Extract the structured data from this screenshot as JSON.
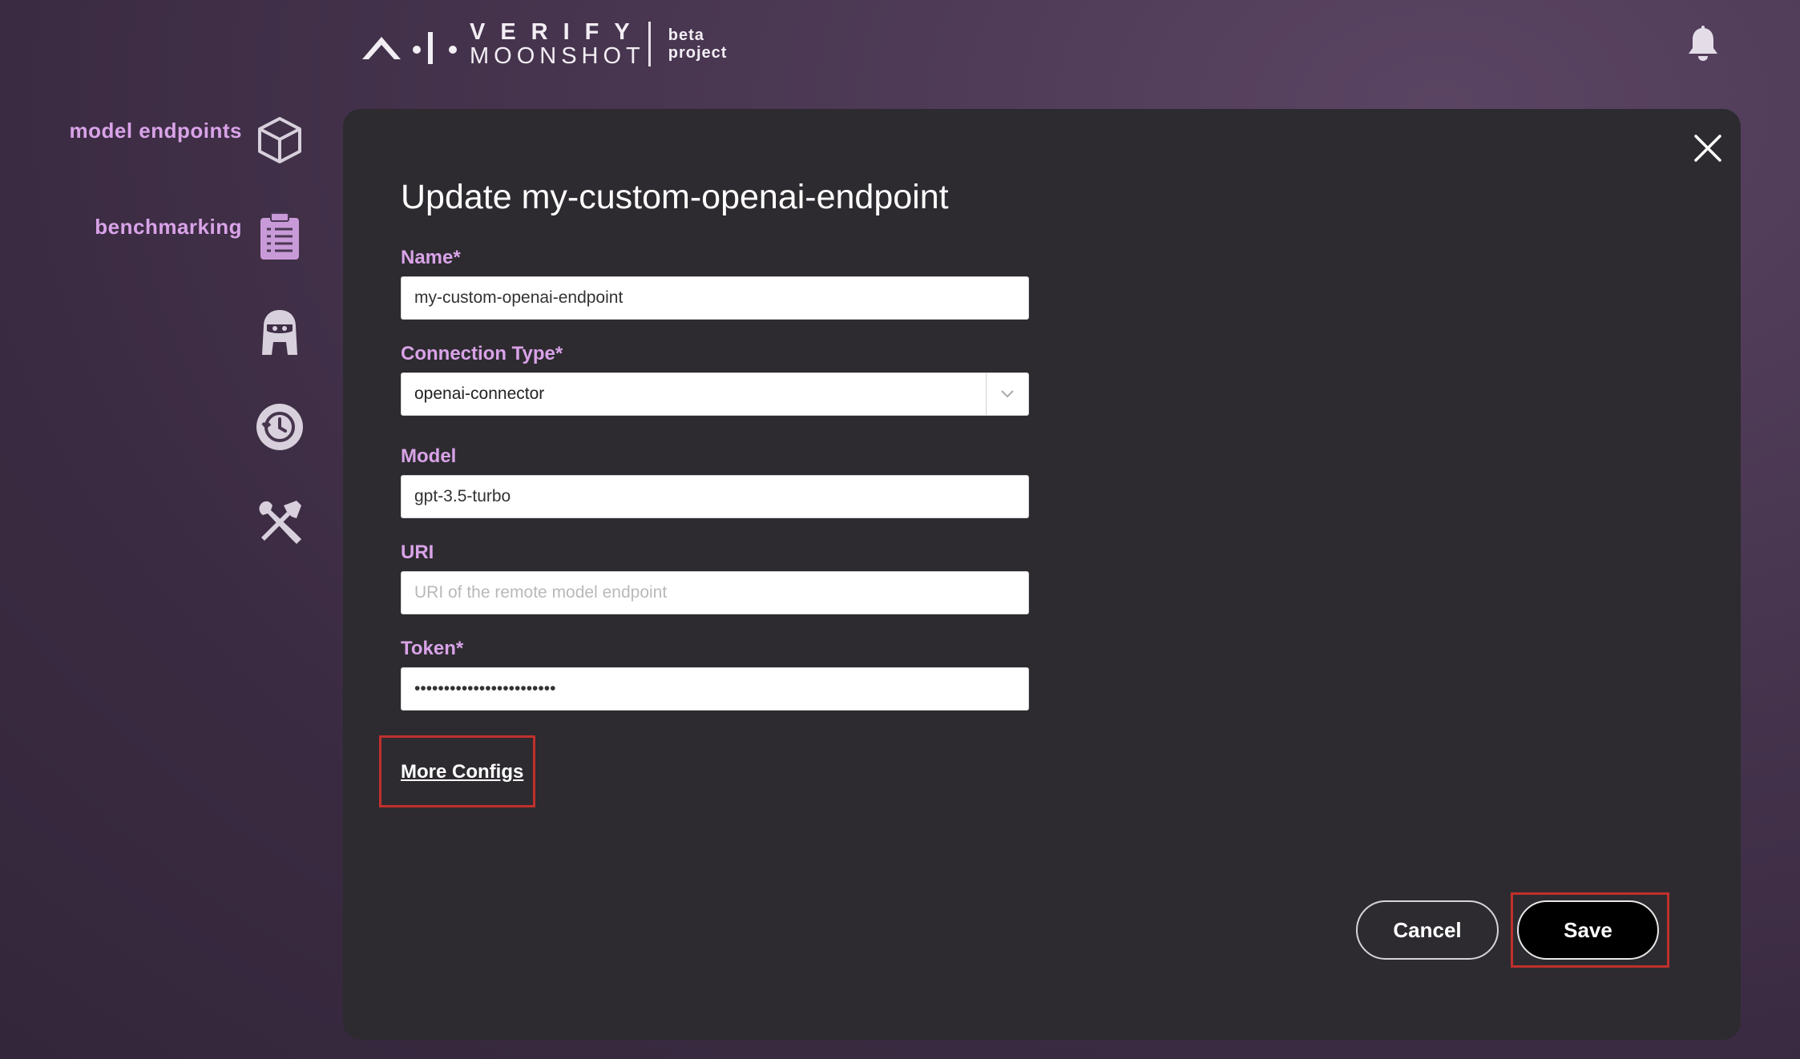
{
  "brand": {
    "line1": "VERIFY",
    "line2": "MOONSHOT",
    "tag1": "beta",
    "tag2": "project"
  },
  "sidebar": {
    "items": [
      {
        "label": "model endpoints",
        "icon": "cube-icon"
      },
      {
        "label": "benchmarking",
        "icon": "clipboard-list-icon"
      },
      {
        "label": "",
        "icon": "red-teaming-agent-icon"
      },
      {
        "label": "",
        "icon": "history-icon"
      },
      {
        "label": "",
        "icon": "tools-icon"
      }
    ]
  },
  "header": {
    "notification_icon": "bell-icon"
  },
  "modal": {
    "title": "Update my-custom-openai-endpoint",
    "fields": {
      "name": {
        "label": "Name*",
        "value": "my-custom-openai-endpoint"
      },
      "connection_type": {
        "label": "Connection Type*",
        "value": "openai-connector"
      },
      "model": {
        "label": "Model",
        "value": "gpt-3.5-turbo"
      },
      "uri": {
        "label": "URI",
        "value": "",
        "placeholder": "URI of the remote model endpoint"
      },
      "token": {
        "label": "Token*",
        "value": "••••••••••••••••••••••••"
      }
    },
    "more_configs_label": "More Configs",
    "cancel_label": "Cancel",
    "save_label": "Save"
  },
  "colors": {
    "accent": "#d9a3e8",
    "highlight": "#c0302c",
    "modal_bg": "#2d2b30"
  }
}
